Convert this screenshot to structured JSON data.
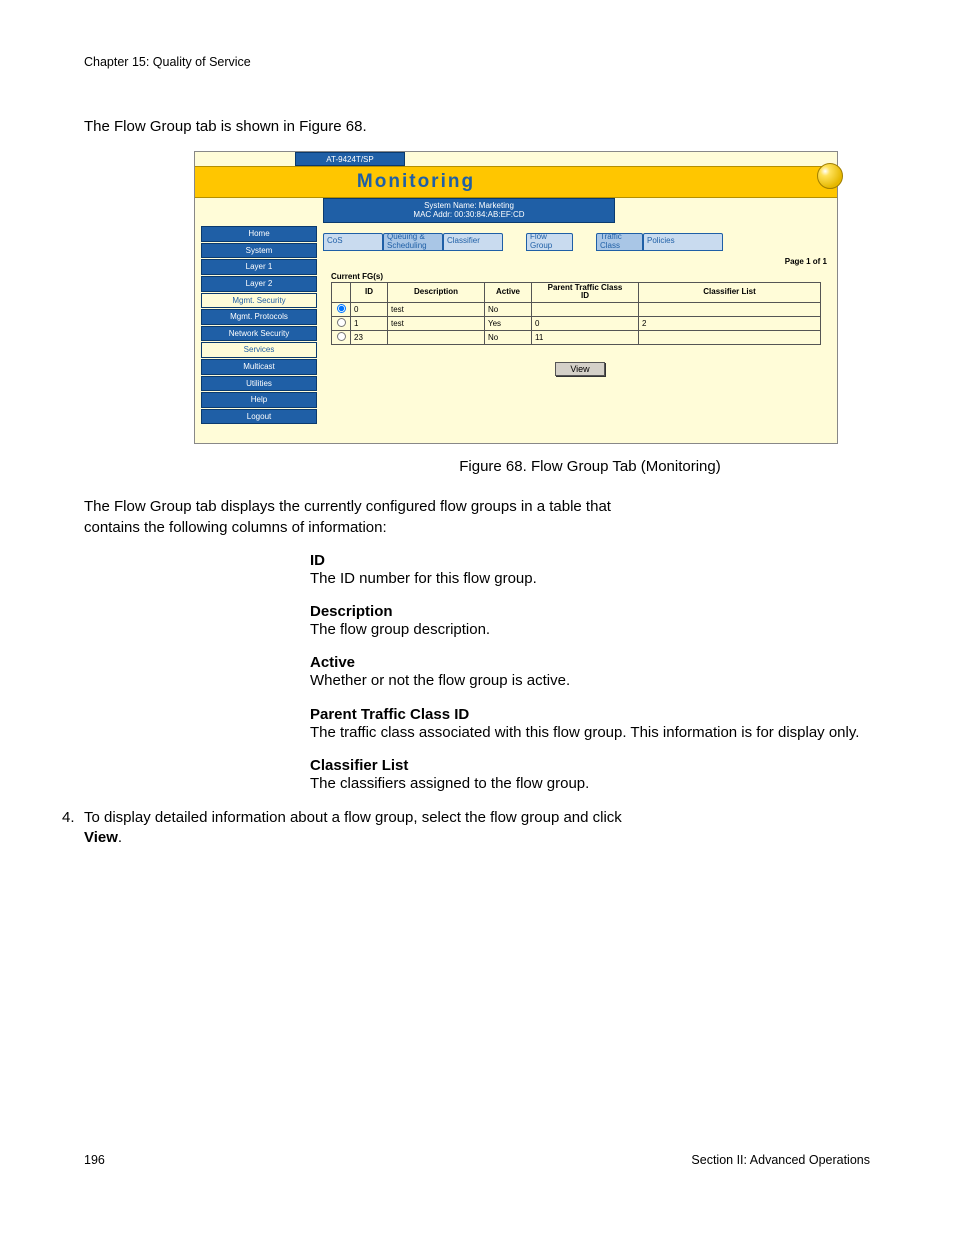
{
  "header": {
    "chapter": "Chapter 15: Quality of Service"
  },
  "intro": "The Flow Group tab is shown in Figure 68.",
  "figure": {
    "device_tab": "AT-9424T/SP",
    "title": "Monitoring",
    "sysinfo_line1": "System Name: Marketing",
    "sysinfo_line2": "MAC Addr: 00:30:84:AB:EF:CD",
    "sidebar": [
      {
        "label": "Home",
        "selected": true
      },
      {
        "label": "System",
        "selected": true
      },
      {
        "label": "Layer 1",
        "selected": true
      },
      {
        "label": "Layer 2",
        "selected": true
      },
      {
        "label": "Mgmt. Security",
        "selected": false
      },
      {
        "label": "Mgmt. Protocols",
        "selected": true
      },
      {
        "label": "Network Security",
        "selected": true
      },
      {
        "label": "Services",
        "selected": false
      },
      {
        "label": "Multicast",
        "selected": true
      },
      {
        "label": "Utilities",
        "selected": true
      },
      {
        "label": "Help",
        "selected": true
      },
      {
        "label": "Logout",
        "selected": true
      }
    ],
    "tabs": {
      "cos": "CoS",
      "queuing": "Queuing &\nScheduling",
      "classifier": "Classifier",
      "flowgroup": "Flow\nGroup",
      "traffic": "Traffic\nClass",
      "policies": "Policies"
    },
    "page_indicator": "Page 1 of 1",
    "table_caption": "Current FG(s)",
    "columns": {
      "id": "ID",
      "description": "Description",
      "active": "Active",
      "parent": "Parent Traffic Class\nID",
      "classifier": "Classifier List"
    },
    "rows": [
      {
        "selected": true,
        "id": "0",
        "description": "test",
        "active": "No",
        "parent": "",
        "classifier": ""
      },
      {
        "selected": false,
        "id": "1",
        "description": "test",
        "active": "Yes",
        "parent": "0",
        "classifier": "2"
      },
      {
        "selected": false,
        "id": "23",
        "description": "",
        "active": "No",
        "parent": "11",
        "classifier": ""
      }
    ],
    "view_button": "View"
  },
  "caption": "Figure 68. Flow Group Tab (Monitoring)",
  "para_after_caption": "The Flow Group tab displays the currently configured flow groups in a table that contains the following columns of information:",
  "defs": [
    {
      "term": "ID",
      "desc": "The ID number for this flow group."
    },
    {
      "term": "Description",
      "desc": "The flow group description."
    },
    {
      "term": "Active",
      "desc": "Whether or not the flow group is active."
    },
    {
      "term": "Parent Traffic Class ID",
      "desc": "The traffic class associated with this flow group. This information is for display only."
    },
    {
      "term": "Classifier List",
      "desc": "The classifiers assigned to the flow group."
    }
  ],
  "step": {
    "num": "4.",
    "text_a": "To display detailed information about a flow group, select the flow group and click ",
    "bold": "View",
    "text_b": "."
  },
  "footer": {
    "page": "196",
    "section": "Section II: Advanced Operations"
  }
}
